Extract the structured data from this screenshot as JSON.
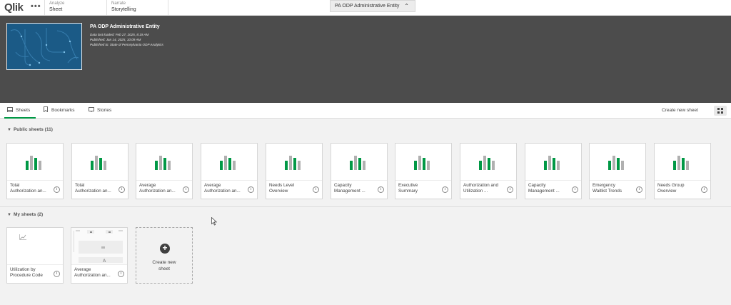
{
  "topbar": {
    "logo": "Qlik",
    "menu_dots": "•••",
    "analyze": {
      "small": "Analyze",
      "big": "Sheet"
    },
    "narrate": {
      "small": "Narrate",
      "big": "Storytelling"
    },
    "app_title": "PA ODP Administrative Entity",
    "app_title_chevron": "⌃"
  },
  "hero": {
    "title": "PA ODP Administrative Entity",
    "data_loaded": "Data last loaded: Feb 27, 2025, 8:19 AM",
    "published": "Published: Jan 14, 2025, 10:09 AM",
    "published_to": "Published to: State of Pennsylvania ODP Analytics"
  },
  "tabs": {
    "sheets": "Sheets",
    "bookmarks": "Bookmarks",
    "stories": "Stories",
    "create_new_sheet": "Create new sheet"
  },
  "public_sheets": {
    "heading": "Public sheets (11)",
    "items": [
      {
        "line1": "Total",
        "line2": "Authorization an..."
      },
      {
        "line1": "Total",
        "line2": "Authorization an..."
      },
      {
        "line1": "Average",
        "line2": "Authorization an..."
      },
      {
        "line1": "Average",
        "line2": "Authorization an..."
      },
      {
        "line1": "Needs Level",
        "line2": "Overview"
      },
      {
        "line1": "Capacity",
        "line2": "Management ..."
      },
      {
        "line1": "Executive",
        "line2": "Summary"
      },
      {
        "line1": "Authorization and",
        "line2": "Utilization ..."
      },
      {
        "line1": "Capacity",
        "line2": "Management ..."
      },
      {
        "line1": "Emergency",
        "line2": "Waitlist Trends"
      },
      {
        "line1": "Needs Group",
        "line2": "Overview"
      }
    ]
  },
  "my_sheets": {
    "heading": "My sheets (2)",
    "items": [
      {
        "line1": "Utilization by",
        "line2": "Procedure Code"
      },
      {
        "line1": "Average",
        "line2": "Authorization an..."
      }
    ],
    "create_card": {
      "line1": "Create new",
      "line2": "sheet"
    }
  },
  "info_glyph": "i",
  "colors": {
    "accent_green": "#009845",
    "bar_gray": "#b0b0b0",
    "hero_bg": "#4c4c4c",
    "thumb_blue": "#1b5a86"
  }
}
